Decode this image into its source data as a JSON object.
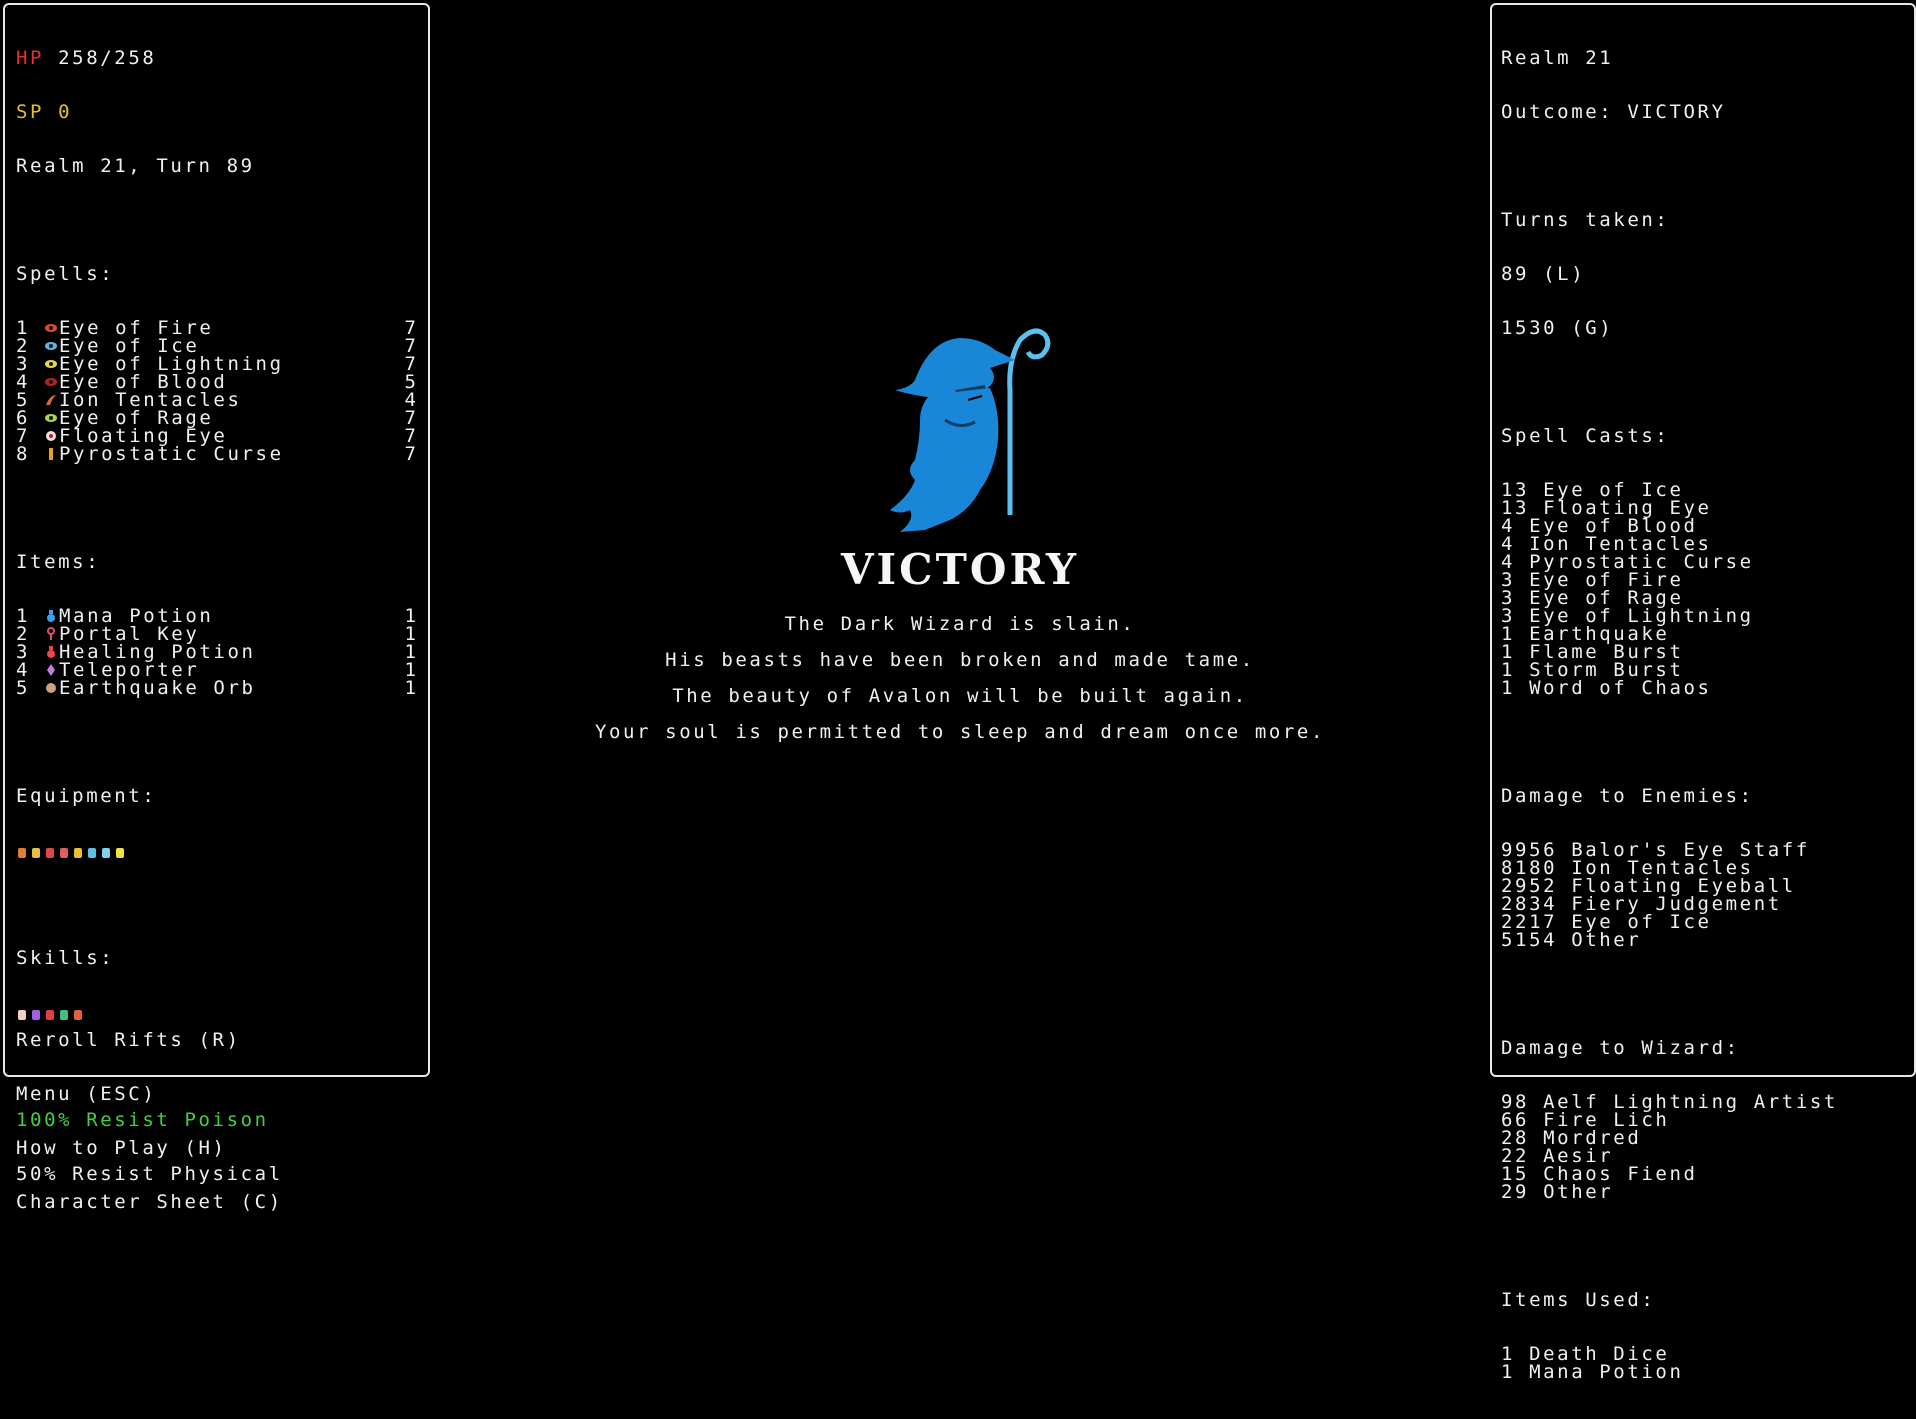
{
  "left": {
    "hp_label": "HP",
    "hp_value": "258/258",
    "sp_label": "SP",
    "sp_value": "0",
    "realm_turn": "Realm 21, Turn 89",
    "spells_header": "Spells:",
    "spells": [
      {
        "num": "1",
        "name": "Eye of Fire",
        "charges": "7",
        "icon": "fire-eye-icon",
        "color": "#e04a2a"
      },
      {
        "num": "2",
        "name": "Eye of Ice",
        "charges": "7",
        "icon": "ice-eye-icon",
        "color": "#5ab6e8"
      },
      {
        "num": "3",
        "name": "Eye of Lightning",
        "charges": "7",
        "icon": "lightning-eye-icon",
        "color": "#e8d84a"
      },
      {
        "num": "4",
        "name": "Eye of Blood",
        "charges": "5",
        "icon": "blood-eye-icon",
        "color": "#b82020"
      },
      {
        "num": "5",
        "name": "Ion Tentacles",
        "charges": "4",
        "icon": "tentacle-icon",
        "color": "#d86a3a"
      },
      {
        "num": "6",
        "name": "Eye of Rage",
        "charges": "7",
        "icon": "rage-eye-icon",
        "color": "#a8d848"
      },
      {
        "num": "7",
        "name": "Floating Eye",
        "charges": "7",
        "icon": "floating-eye-icon",
        "color": "#f0e0e0"
      },
      {
        "num": "8",
        "name": "Pyrostatic Curse",
        "charges": "7",
        "icon": "curse-icon",
        "color": "#e8a020"
      }
    ],
    "items_header": "Items:",
    "items": [
      {
        "num": "1",
        "name": "Mana Potion",
        "count": "1",
        "icon": "mana-potion-icon",
        "color": "#3aa0f0"
      },
      {
        "num": "2",
        "name": "Portal Key",
        "count": "1",
        "icon": "key-icon",
        "color": "#e0506a"
      },
      {
        "num": "3",
        "name": "Healing Potion",
        "count": "1",
        "icon": "healing-potion-icon",
        "color": "#e84848"
      },
      {
        "num": "4",
        "name": "Teleporter",
        "count": "1",
        "icon": "teleporter-icon",
        "color": "#c080e0"
      },
      {
        "num": "5",
        "name": "Earthquake Orb",
        "count": "1",
        "icon": "orb-icon",
        "color": "#d0a080"
      }
    ],
    "equipment_header": "Equipment:",
    "equipment_icons": [
      {
        "icon": "staff-icon",
        "color": "#e08030"
      },
      {
        "icon": "amulet-icon",
        "color": "#e8c040"
      },
      {
        "icon": "mask-icon",
        "color": "#e04848"
      },
      {
        "icon": "skull-icon",
        "color": "#e06060"
      },
      {
        "icon": "snake-icon",
        "color": "#e8c030"
      },
      {
        "icon": "wand-icon",
        "color": "#60c0e0"
      },
      {
        "icon": "wand-icon",
        "color": "#80d0f0"
      },
      {
        "icon": "ring-icon",
        "color": "#f0e040"
      }
    ],
    "skills_header": "Skills:",
    "skill_icons": [
      {
        "icon": "skull-skill-icon",
        "color": "#f0d0c0"
      },
      {
        "icon": "eye-skill-icon",
        "color": "#a060e0"
      },
      {
        "icon": "fire-skill-icon",
        "color": "#e04040"
      },
      {
        "icon": "tree-skill-icon",
        "color": "#40c080"
      },
      {
        "icon": "demon-skill-icon",
        "color": "#e06040"
      }
    ],
    "resist_poison": "100% Resist Poison",
    "resist_physical": "50% Resist Physical",
    "menu": {
      "reroll": "Reroll Rifts (R)",
      "menu": "Menu (ESC)",
      "how_to_play": "How to Play (H)",
      "character_sheet": "Character Sheet (C)"
    }
  },
  "center": {
    "title": "VICTORY",
    "messages": [
      "The Dark Wizard is slain.",
      "His beasts have been broken and made tame.",
      "The beauty of Avalon will be built again.",
      "Your soul is permitted to sleep and dream once more."
    ]
  },
  "right": {
    "realm": "Realm 21",
    "outcome": "Outcome: VICTORY",
    "turns_header": "Turns taken:",
    "turns_local": "89 (L)",
    "turns_global": "1530 (G)",
    "spell_casts_header": "Spell Casts:",
    "spell_casts": [
      "13 Eye of Ice",
      "13 Floating Eye",
      "4 Eye of Blood",
      "4 Ion Tentacles",
      "4 Pyrostatic Curse",
      "3 Eye of Fire",
      "3 Eye of Rage",
      "3 Eye of Lightning",
      "1 Earthquake",
      "1 Flame Burst",
      "1 Storm Burst",
      "1 Word of Chaos"
    ],
    "damage_enemies_header": "Damage to Enemies:",
    "damage_enemies": [
      "9956 Balor's Eye Staff",
      "8180 Ion Tentacles",
      "2952 Floating Eyeball",
      "2834 Fiery Judgement",
      "2217 Eye of Ice",
      "5154 Other"
    ],
    "damage_wizard_header": "Damage to Wizard:",
    "damage_wizard": [
      "98 Aelf Lightning Artist",
      "66 Fire Lich",
      "28 Mordred",
      "22 Aesir",
      "15 Chaos Fiend",
      "29 Other"
    ],
    "items_used_header": "Items Used:",
    "items_used": [
      "1 Death Dice",
      "1 Mana Potion"
    ]
  },
  "colors": {
    "hp": "#e83030",
    "sp": "#e8c020",
    "resist_poison": "#40d040",
    "border": "#e8e8e8",
    "wizard_blue": "#1a86d8",
    "staff_blue": "#5ac0f0"
  }
}
